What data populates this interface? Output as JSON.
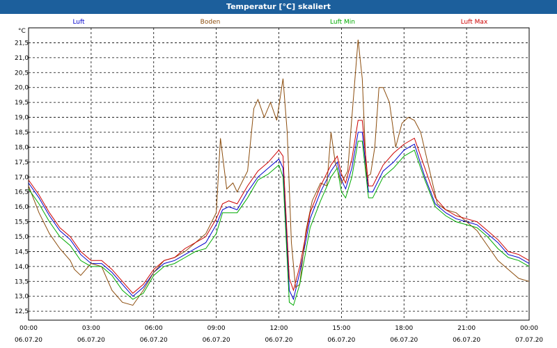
{
  "window": {
    "title": "Temperatur [°C] skaliert"
  },
  "chart_data": {
    "type": "line",
    "title": "Temperatur [°C] skaliert",
    "ylabel": "°C",
    "ylim": [
      12.2,
      22.0
    ],
    "y_ticks": [
      "12,5",
      "13,0",
      "13,5",
      "14,0",
      "14,5",
      "15,0",
      "15,5",
      "16,0",
      "16,5",
      "17,0",
      "17,5",
      "18,0",
      "18,5",
      "19,0",
      "19,5",
      "20,0",
      "20,5",
      "21,0",
      "21,5"
    ],
    "x_range": [
      0,
      24
    ],
    "x_ticks": [
      {
        "x": 0,
        "time": "00:00",
        "date": "06.07.20"
      },
      {
        "x": 3,
        "time": "03:00",
        "date": "06.07.20"
      },
      {
        "x": 6,
        "time": "06:00",
        "date": "06.07.20"
      },
      {
        "x": 9,
        "time": "09:00",
        "date": "06.07.20"
      },
      {
        "x": 12,
        "time": "12:00",
        "date": "06.07.20"
      },
      {
        "x": 15,
        "time": "15:00",
        "date": "06.07.20"
      },
      {
        "x": 18,
        "time": "18:00",
        "date": "06.07.20"
      },
      {
        "x": 21,
        "time": "21:00",
        "date": "06.07.20"
      },
      {
        "x": 24,
        "time": "00:00",
        "date": "07.07.20"
      }
    ],
    "grid": true,
    "legend_position": "top",
    "series": [
      {
        "name": "Luft",
        "color": "#0000cc",
        "points": [
          [
            0,
            16.8
          ],
          [
            0.5,
            16.3
          ],
          [
            1,
            15.7
          ],
          [
            1.5,
            15.2
          ],
          [
            2,
            14.9
          ],
          [
            2.5,
            14.4
          ],
          [
            3,
            14.1
          ],
          [
            3.5,
            14.1
          ],
          [
            4,
            13.8
          ],
          [
            4.5,
            13.4
          ],
          [
            5,
            13.0
          ],
          [
            5.5,
            13.3
          ],
          [
            6,
            13.8
          ],
          [
            6.5,
            14.1
          ],
          [
            7,
            14.2
          ],
          [
            7.5,
            14.4
          ],
          [
            8,
            14.6
          ],
          [
            8.5,
            14.8
          ],
          [
            9,
            15.4
          ],
          [
            9.3,
            15.9
          ],
          [
            9.6,
            16.0
          ],
          [
            10,
            15.9
          ],
          [
            10.5,
            16.5
          ],
          [
            11,
            17.0
          ],
          [
            11.5,
            17.3
          ],
          [
            12,
            17.6
          ],
          [
            12.2,
            17.3
          ],
          [
            12.5,
            13.2
          ],
          [
            12.7,
            12.9
          ],
          [
            13,
            13.8
          ],
          [
            13.5,
            15.6
          ],
          [
            14,
            16.5
          ],
          [
            14.5,
            17.2
          ],
          [
            14.8,
            17.5
          ],
          [
            15,
            16.9
          ],
          [
            15.2,
            16.6
          ],
          [
            15.5,
            17.3
          ],
          [
            15.8,
            18.5
          ],
          [
            16,
            18.5
          ],
          [
            16.3,
            16.5
          ],
          [
            16.5,
            16.5
          ],
          [
            17,
            17.2
          ],
          [
            17.5,
            17.5
          ],
          [
            18,
            17.9
          ],
          [
            18.5,
            18.1
          ],
          [
            19,
            17.0
          ],
          [
            19.5,
            16.1
          ],
          [
            20,
            15.8
          ],
          [
            20.5,
            15.6
          ],
          [
            21,
            15.5
          ],
          [
            21.5,
            15.4
          ],
          [
            22,
            15.1
          ],
          [
            22.5,
            14.8
          ],
          [
            23,
            14.4
          ],
          [
            23.5,
            14.3
          ],
          [
            24,
            14.1
          ]
        ]
      },
      {
        "name": "Boden",
        "color": "#8b4c0c",
        "points": [
          [
            0,
            16.7
          ],
          [
            0.5,
            15.8
          ],
          [
            1,
            15.1
          ],
          [
            1.5,
            14.6
          ],
          [
            2,
            14.2
          ],
          [
            2.2,
            13.9
          ],
          [
            2.5,
            13.7
          ],
          [
            3,
            14.1
          ],
          [
            3.5,
            14.0
          ],
          [
            4,
            13.2
          ],
          [
            4.5,
            12.8
          ],
          [
            5,
            12.7
          ],
          [
            5.5,
            13.2
          ],
          [
            6,
            13.8
          ],
          [
            6.5,
            14.2
          ],
          [
            7,
            14.3
          ],
          [
            7.5,
            14.5
          ],
          [
            8,
            14.8
          ],
          [
            8.5,
            15.1
          ],
          [
            9,
            15.8
          ],
          [
            9.2,
            18.3
          ],
          [
            9.5,
            16.6
          ],
          [
            9.8,
            16.8
          ],
          [
            10,
            16.5
          ],
          [
            10.5,
            17.2
          ],
          [
            10.8,
            19.3
          ],
          [
            11,
            19.6
          ],
          [
            11.3,
            19.0
          ],
          [
            11.6,
            19.5
          ],
          [
            11.9,
            18.9
          ],
          [
            12.2,
            20.3
          ],
          [
            12.4,
            18.5
          ],
          [
            12.6,
            14.8
          ],
          [
            12.8,
            13.3
          ],
          [
            13,
            13.4
          ],
          [
            13.3,
            15.2
          ],
          [
            13.6,
            16.2
          ],
          [
            14,
            16.8
          ],
          [
            14.3,
            16.7
          ],
          [
            14.5,
            18.5
          ],
          [
            14.7,
            17.5
          ],
          [
            15,
            16.8
          ],
          [
            15.3,
            17.2
          ],
          [
            15.5,
            19.0
          ],
          [
            15.8,
            21.6
          ],
          [
            16,
            20.3
          ],
          [
            16.2,
            17.0
          ],
          [
            16.4,
            17.1
          ],
          [
            16.6,
            18.0
          ],
          [
            16.8,
            20.0
          ],
          [
            17,
            20.0
          ],
          [
            17.3,
            19.5
          ],
          [
            17.6,
            18.0
          ],
          [
            17.9,
            18.8
          ],
          [
            18.2,
            19.0
          ],
          [
            18.5,
            18.9
          ],
          [
            18.8,
            18.5
          ],
          [
            19.2,
            17.3
          ],
          [
            19.6,
            16.1
          ],
          [
            20,
            15.9
          ],
          [
            20.5,
            15.8
          ],
          [
            21,
            15.5
          ],
          [
            21.5,
            15.2
          ],
          [
            22,
            14.7
          ],
          [
            22.5,
            14.2
          ],
          [
            23,
            13.9
          ],
          [
            23.5,
            13.6
          ],
          [
            24,
            13.5
          ]
        ]
      },
      {
        "name": "Luft Min",
        "color": "#00aa00",
        "points": [
          [
            0,
            16.6
          ],
          [
            0.5,
            16.1
          ],
          [
            1,
            15.5
          ],
          [
            1.5,
            15.0
          ],
          [
            2,
            14.7
          ],
          [
            2.5,
            14.2
          ],
          [
            3,
            14.0
          ],
          [
            3.5,
            14.0
          ],
          [
            4,
            13.7
          ],
          [
            4.5,
            13.2
          ],
          [
            5,
            12.9
          ],
          [
            5.5,
            13.1
          ],
          [
            6,
            13.7
          ],
          [
            6.5,
            14.0
          ],
          [
            7,
            14.1
          ],
          [
            7.5,
            14.3
          ],
          [
            8,
            14.5
          ],
          [
            8.5,
            14.6
          ],
          [
            9,
            15.1
          ],
          [
            9.3,
            15.8
          ],
          [
            9.6,
            15.8
          ],
          [
            10,
            15.8
          ],
          [
            10.5,
            16.3
          ],
          [
            11,
            16.9
          ],
          [
            11.5,
            17.1
          ],
          [
            12,
            17.4
          ],
          [
            12.2,
            17.0
          ],
          [
            12.5,
            12.8
          ],
          [
            12.7,
            12.7
          ],
          [
            13,
            13.4
          ],
          [
            13.5,
            15.3
          ],
          [
            14,
            16.2
          ],
          [
            14.5,
            17.0
          ],
          [
            14.8,
            17.3
          ],
          [
            15,
            16.5
          ],
          [
            15.2,
            16.3
          ],
          [
            15.5,
            17.0
          ],
          [
            15.8,
            18.2
          ],
          [
            16,
            18.2
          ],
          [
            16.3,
            16.3
          ],
          [
            16.5,
            16.3
          ],
          [
            17,
            17.0
          ],
          [
            17.5,
            17.3
          ],
          [
            18,
            17.7
          ],
          [
            18.5,
            17.9
          ],
          [
            19,
            16.9
          ],
          [
            19.5,
            16.0
          ],
          [
            20,
            15.7
          ],
          [
            20.5,
            15.5
          ],
          [
            21,
            15.4
          ],
          [
            21.5,
            15.3
          ],
          [
            22,
            15.0
          ],
          [
            22.5,
            14.6
          ],
          [
            23,
            14.3
          ],
          [
            23.5,
            14.2
          ],
          [
            24,
            14.0
          ]
        ]
      },
      {
        "name": "Luft Max",
        "color": "#cc0000",
        "points": [
          [
            0,
            16.9
          ],
          [
            0.5,
            16.4
          ],
          [
            1,
            15.8
          ],
          [
            1.5,
            15.3
          ],
          [
            2,
            15.0
          ],
          [
            2.5,
            14.5
          ],
          [
            3,
            14.2
          ],
          [
            3.5,
            14.2
          ],
          [
            4,
            13.9
          ],
          [
            4.5,
            13.5
          ],
          [
            5,
            13.1
          ],
          [
            5.5,
            13.4
          ],
          [
            6,
            13.9
          ],
          [
            6.5,
            14.2
          ],
          [
            7,
            14.3
          ],
          [
            7.5,
            14.6
          ],
          [
            8,
            14.8
          ],
          [
            8.5,
            15.0
          ],
          [
            9,
            15.6
          ],
          [
            9.3,
            16.1
          ],
          [
            9.6,
            16.2
          ],
          [
            10,
            16.1
          ],
          [
            10.5,
            16.7
          ],
          [
            11,
            17.2
          ],
          [
            11.5,
            17.5
          ],
          [
            12,
            17.9
          ],
          [
            12.2,
            17.7
          ],
          [
            12.5,
            13.6
          ],
          [
            12.7,
            13.2
          ],
          [
            13,
            14.0
          ],
          [
            13.5,
            15.8
          ],
          [
            14,
            16.7
          ],
          [
            14.5,
            17.4
          ],
          [
            14.8,
            17.7
          ],
          [
            15,
            17.1
          ],
          [
            15.2,
            16.8
          ],
          [
            15.5,
            17.6
          ],
          [
            15.8,
            18.9
          ],
          [
            16,
            18.9
          ],
          [
            16.3,
            16.7
          ],
          [
            16.5,
            16.7
          ],
          [
            17,
            17.4
          ],
          [
            17.5,
            17.8
          ],
          [
            18,
            18.1
          ],
          [
            18.5,
            18.3
          ],
          [
            19,
            17.3
          ],
          [
            19.5,
            16.3
          ],
          [
            20,
            15.9
          ],
          [
            20.5,
            15.7
          ],
          [
            21,
            15.6
          ],
          [
            21.5,
            15.5
          ],
          [
            22,
            15.2
          ],
          [
            22.5,
            14.9
          ],
          [
            23,
            14.5
          ],
          [
            23.5,
            14.4
          ],
          [
            24,
            14.2
          ]
        ]
      }
    ]
  }
}
